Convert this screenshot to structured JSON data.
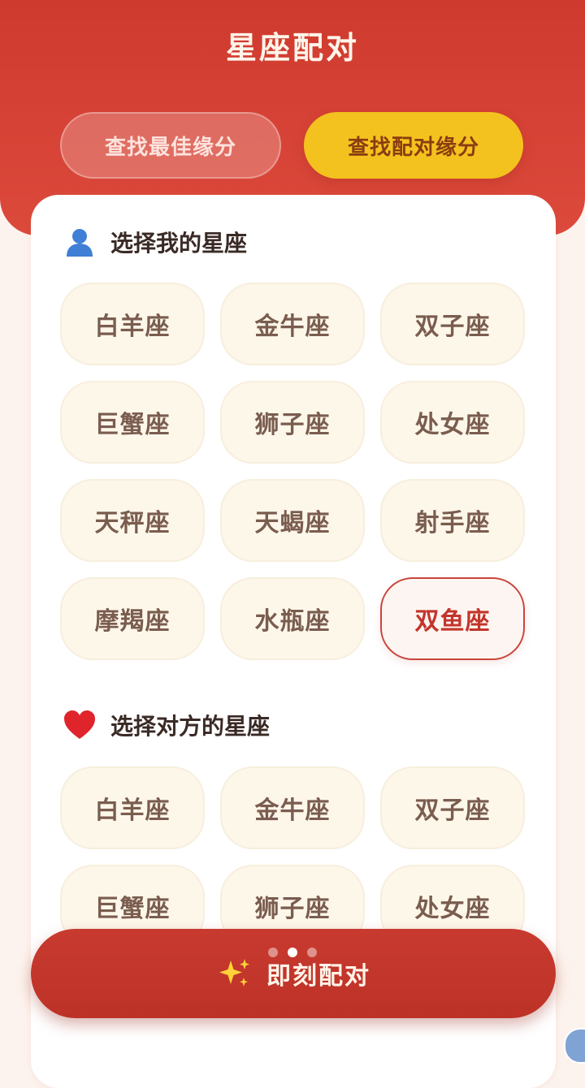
{
  "header": {
    "title": "星座配对",
    "modes": [
      "查找最佳缘分",
      "查找配对缘分"
    ]
  },
  "my_section": {
    "title": "选择我的星座",
    "icon": "person-icon",
    "selected": "双鱼座",
    "signs": [
      "白羊座",
      "金牛座",
      "双子座",
      "巨蟹座",
      "狮子座",
      "处女座",
      "天秤座",
      "天蝎座",
      "射手座",
      "摩羯座",
      "水瓶座",
      "双鱼座"
    ]
  },
  "partner_section": {
    "title": "选择对方的星座",
    "icon": "heart-icon",
    "signs": [
      "白羊座",
      "金牛座",
      "双子座",
      "巨蟹座",
      "狮子座",
      "处女座"
    ]
  },
  "action": {
    "label": "即刻配对",
    "icon": "sparkles-icon"
  },
  "pager": {
    "active_index": 1,
    "count": 3
  },
  "colors": {
    "primary_red": "#cf3a2e",
    "accent_yellow": "#f4c21f",
    "chip_bg": "#fdf7ea",
    "selected_text": "#c2352c"
  }
}
